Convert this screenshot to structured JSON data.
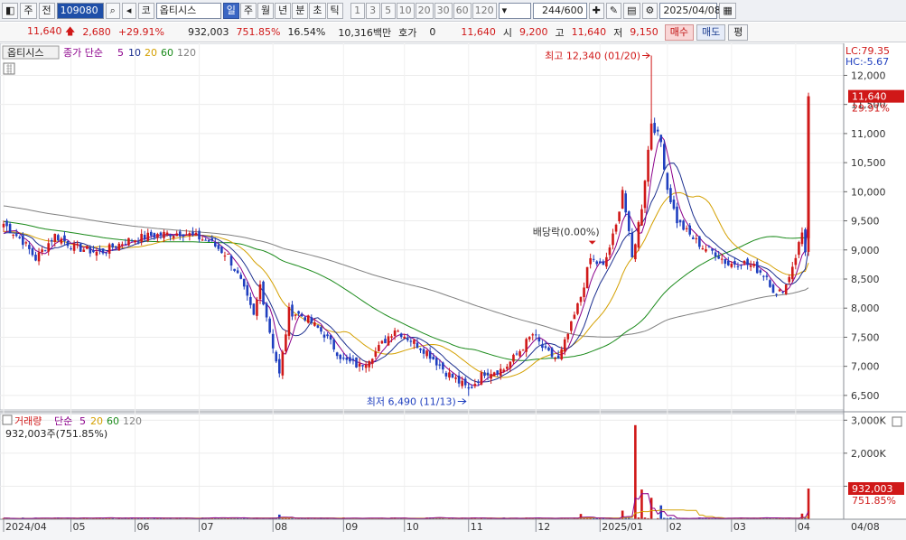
{
  "toolbar": {
    "menu_btn": "◧",
    "period_sel": "주",
    "prev_label": "전",
    "code": "109080",
    "mkt": "코",
    "name": "옵티시스",
    "periods": [
      "일",
      "주",
      "월",
      "년",
      "분",
      "초",
      "틱"
    ],
    "active_period": "일",
    "nums": [
      "1",
      "3",
      "5",
      "10",
      "20",
      "30",
      "60",
      "120"
    ],
    "count": "244/600",
    "date": "2025/04/08"
  },
  "quote": {
    "price": "11,640",
    "change": "2,680",
    "change_pct": "+29.91%",
    "volume": "932,003",
    "vol_ratio": "751.85%",
    "turnover": "16.54%",
    "amount": "10,316백만",
    "hoga_label": "호가",
    "hoga_val": "0",
    "hoga_price": "11,640",
    "open_label": "시",
    "open": "9,200",
    "high_label": "고",
    "high": "11,640",
    "low_label": "저",
    "low": "9,150",
    "buy": "매수",
    "sell": "매도",
    "eval": "평"
  },
  "price_panel": {
    "name_tag": "옵티시스",
    "ma_title": "종가 단순",
    "lc": "LC:79.35",
    "hc": "HC:-5.67",
    "high_annot": "최고 12,340 (01/20)",
    "low_annot": "최저 6,490 (11/13)",
    "div_annot": "배당락(0.00%)",
    "last_price": "11,640",
    "last_pct": "29.91%"
  },
  "volume_panel": {
    "title": "거래량",
    "ma_title": "단순",
    "current": "932,003주(751.85%)",
    "last_vol": "932,003",
    "last_pct": "751.85%"
  },
  "colors": {
    "up": "#d01818",
    "down": "#1f3fbf",
    "ma5": "#8b008b",
    "ma10": "#1c2f8f",
    "ma20": "#d4a000",
    "ma60": "#1a8a1a",
    "ma120": "#808080"
  },
  "chart_data": {
    "type": "candlestick",
    "y_ticks": [
      6500,
      7000,
      7500,
      8000,
      8500,
      9000,
      9500,
      10000,
      10500,
      11000,
      11500,
      12000
    ],
    "ylim": [
      6250,
      12550
    ],
    "vol_ticks": [
      "1,000K",
      "2,000K",
      "3,000K"
    ],
    "vol_tick_values": [
      1000,
      2000,
      3000
    ],
    "vol_ylim": [
      0,
      3200
    ],
    "ma_periods": [
      "5",
      "10",
      "20",
      "60",
      "120"
    ],
    "x_labels": [
      {
        "label": "2024/04",
        "i": 0
      },
      {
        "label": "05",
        "i": 21
      },
      {
        "label": "06",
        "i": 41
      },
      {
        "label": "07",
        "i": 61
      },
      {
        "label": "08",
        "i": 84
      },
      {
        "label": "09",
        "i": 106
      },
      {
        "label": "10",
        "i": 125
      },
      {
        "label": "11",
        "i": 145
      },
      {
        "label": "12",
        "i": 166
      },
      {
        "label": "2025/01",
        "i": 186
      },
      {
        "label": "02",
        "i": 207
      },
      {
        "label": "03",
        "i": 227
      },
      {
        "label": "04",
        "i": 247
      }
    ],
    "x_axis_end_label": "04/08",
    "anchors": [
      [
        0,
        9450
      ],
      [
        6,
        9150
      ],
      [
        10,
        8850
      ],
      [
        16,
        9250
      ],
      [
        22,
        9050
      ],
      [
        30,
        8950
      ],
      [
        38,
        9150
      ],
      [
        46,
        9250
      ],
      [
        56,
        9300
      ],
      [
        64,
        9150
      ],
      [
        70,
        8900
      ],
      [
        74,
        8450
      ],
      [
        78,
        7850
      ],
      [
        80,
        8400
      ],
      [
        83,
        7600
      ],
      [
        86,
        6850
      ],
      [
        89,
        7950
      ],
      [
        94,
        7850
      ],
      [
        100,
        7550
      ],
      [
        106,
        7100
      ],
      [
        111,
        7000
      ],
      [
        116,
        7250
      ],
      [
        122,
        7650
      ],
      [
        127,
        7450
      ],
      [
        132,
        7250
      ],
      [
        138,
        6900
      ],
      [
        145,
        6600
      ],
      [
        150,
        6900
      ],
      [
        156,
        6950
      ],
      [
        160,
        7200
      ],
      [
        165,
        7550
      ],
      [
        169,
        7250
      ],
      [
        173,
        7100
      ],
      [
        177,
        7700
      ],
      [
        180,
        8200
      ],
      [
        183,
        8850
      ],
      [
        187,
        8700
      ],
      [
        191,
        9400
      ],
      [
        193,
        10050
      ],
      [
        196,
        8850
      ],
      [
        199,
        9750
      ],
      [
        202,
        11200
      ],
      [
        205,
        10850
      ],
      [
        207,
        10050
      ],
      [
        210,
        9500
      ],
      [
        214,
        9250
      ],
      [
        218,
        9050
      ],
      [
        222,
        8950
      ],
      [
        226,
        8750
      ],
      [
        230,
        8800
      ],
      [
        234,
        8700
      ],
      [
        238,
        8550
      ],
      [
        241,
        8200
      ],
      [
        244,
        8400
      ],
      [
        247,
        8900
      ],
      [
        249,
        9300
      ],
      [
        250,
        9000
      ],
      [
        251,
        11640
      ]
    ],
    "volume_spikes": [
      {
        "i": 197,
        "v": 2850
      },
      {
        "i": 199,
        "v": 900
      },
      {
        "i": 202,
        "v": 650
      },
      {
        "i": 205,
        "v": 420
      },
      {
        "i": 193,
        "v": 260
      },
      {
        "i": 180,
        "v": 160
      },
      {
        "i": 86,
        "v": 140
      },
      {
        "i": 251,
        "v": 930
      },
      {
        "i": 249,
        "v": 170
      }
    ],
    "high": {
      "value": 12340,
      "date": "01/20",
      "i": 202
    },
    "low": {
      "value": 6490,
      "date": "11/13",
      "i": 145
    },
    "last": {
      "value": 11640,
      "pct": 29.91
    }
  }
}
